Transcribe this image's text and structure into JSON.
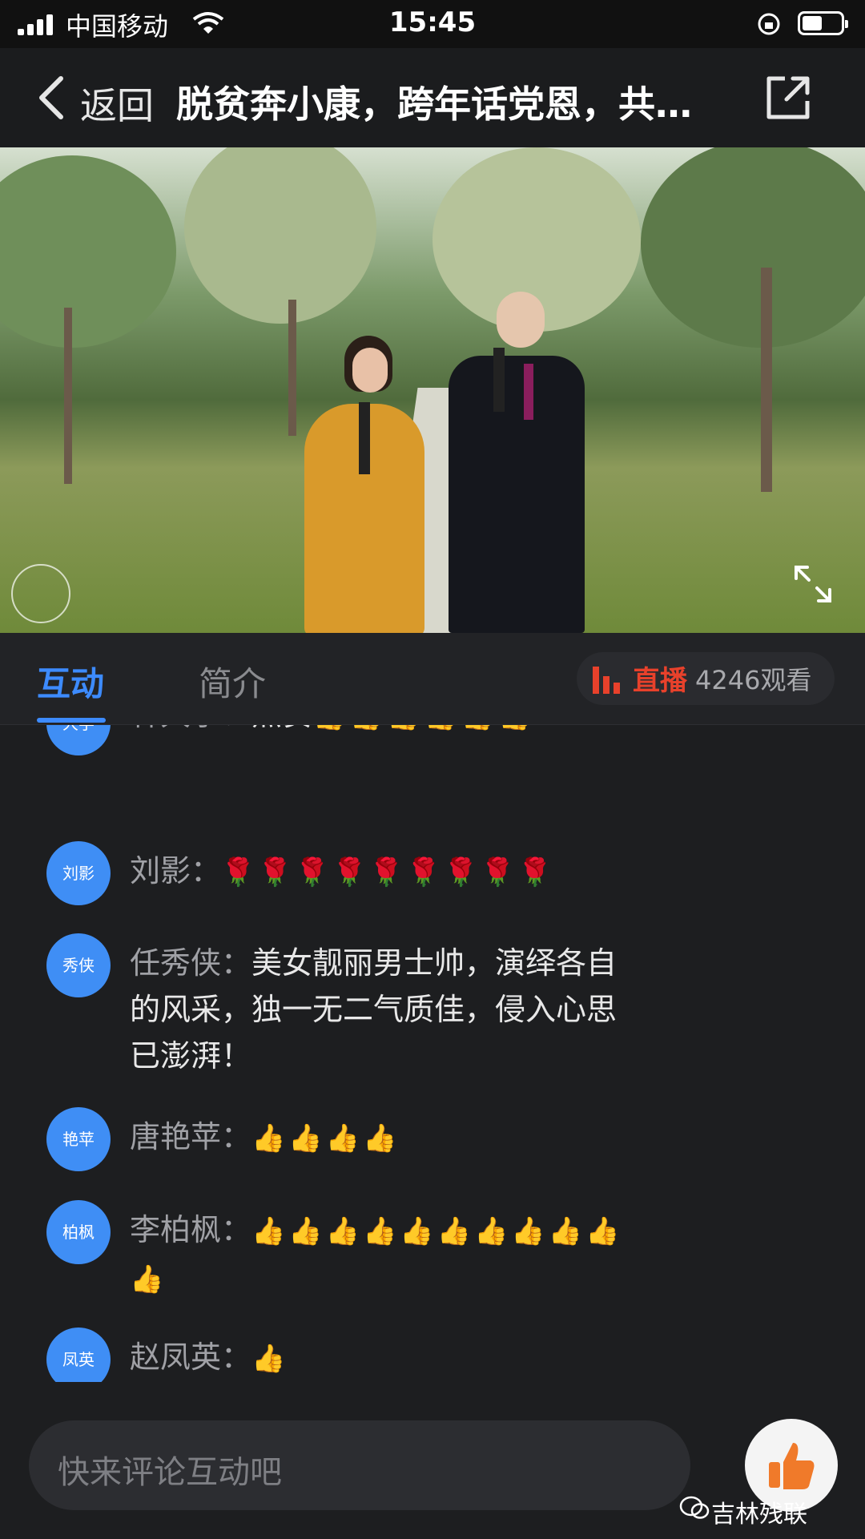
{
  "status_bar": {
    "carrier": "中国移动",
    "time": "15:45"
  },
  "nav": {
    "back_label": "返回",
    "title": "脱贫奔小康，跨年话党恩，共…"
  },
  "tabs": {
    "interact": "互动",
    "intro": "简介",
    "live_label": "直播",
    "viewers": "4246观看"
  },
  "comments": [
    {
      "avatar": "大学",
      "name": "林大学：",
      "text": "点赞",
      "emoji": "👍👍👍👍👍👍"
    },
    {
      "avatar": "刘影",
      "name": "刘影：",
      "text": "",
      "emoji": "🌹🌹🌹🌹🌹🌹🌹🌹🌹"
    },
    {
      "avatar": "秀侠",
      "name": "任秀侠：",
      "text": "美女靓丽男士帅，演绎各自的风采，独一无二气质佳，侵入心思已澎湃！",
      "emoji": ""
    },
    {
      "avatar": "艳苹",
      "name": "唐艳苹：",
      "text": "",
      "emoji": "👍👍👍👍"
    },
    {
      "avatar": "柏枫",
      "name": "李柏枫：",
      "text": "",
      "emoji": "👍👍👍👍👍👍👍👍👍👍👍"
    },
    {
      "avatar": "凤英",
      "name": "赵凤英：",
      "text": "",
      "emoji": "👍"
    }
  ],
  "input": {
    "placeholder": "快来评论互动吧"
  },
  "watermark": "吉林残联",
  "colors": {
    "accent": "#3d8bff",
    "live": "#e8412b",
    "avatar": "#3f8ef5"
  }
}
